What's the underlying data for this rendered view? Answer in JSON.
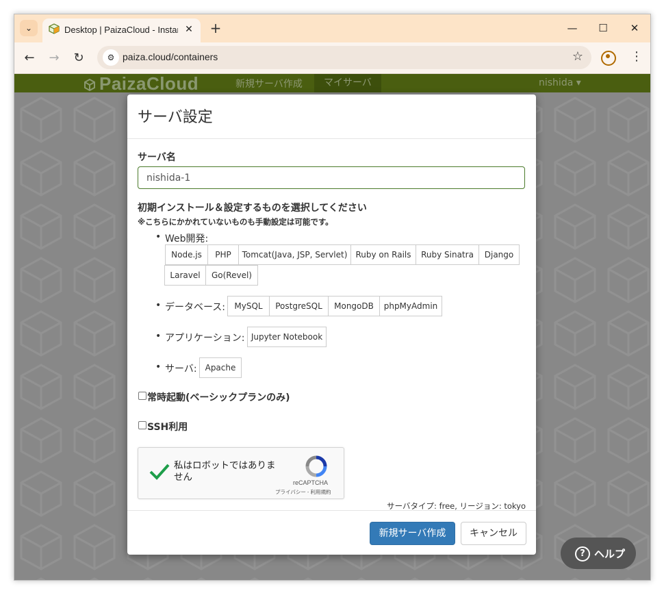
{
  "browser": {
    "tab_title": "Desktop | PaizaCloud - Instant L",
    "new_tab": "+",
    "url": "paiza.cloud/containers",
    "min_glyph": "—",
    "max_glyph": "☐",
    "close_glyph": "✕"
  },
  "site_nav": {
    "brand": "PaizaCloud",
    "link_new_server": "新規サーバ作成",
    "link_my_server": "マイサーバ",
    "user": "nishida ▾"
  },
  "modal": {
    "title": "サーバ設定",
    "server_name_label": "サーバ名",
    "server_name_value": "nishida-1",
    "install_heading": "初期インストール＆設定するものを選択してください",
    "install_note": "※こちらにかかれていないものも手動設定は可能です。",
    "categories": {
      "web": {
        "label": "Web開発:",
        "options": [
          "Node.js",
          "PHP",
          "Tomcat(Java, JSP, Servlet)",
          "Ruby on Rails",
          "Ruby Sinatra",
          "Django",
          "Laravel",
          "Go(Revel)"
        ]
      },
      "db": {
        "label": "データベース:",
        "options": [
          "MySQL",
          "PostgreSQL",
          "MongoDB",
          "phpMyAdmin"
        ]
      },
      "app": {
        "label": "アプリケーション:",
        "options": [
          "Jupyter Notebook"
        ]
      },
      "server": {
        "label": "サーバ:",
        "options": [
          "Apache"
        ]
      }
    },
    "always_on_label": "常時起動(ベーシックプランのみ)",
    "ssh_label": "SSH利用",
    "recaptcha": {
      "text": "私はロボットではありません",
      "brand": "reCAPTCHA",
      "links": "プライバシー - 利用規約"
    },
    "server_type": "サーバタイプ: free, リージョン: tokyo",
    "create_button": "新規サーバ作成",
    "cancel_button": "キャンセル"
  },
  "help": {
    "label": "ヘルプ"
  },
  "colors": {
    "site_nav": "#4a5e10",
    "primary": "#337ab7",
    "overlay": "#888888"
  }
}
